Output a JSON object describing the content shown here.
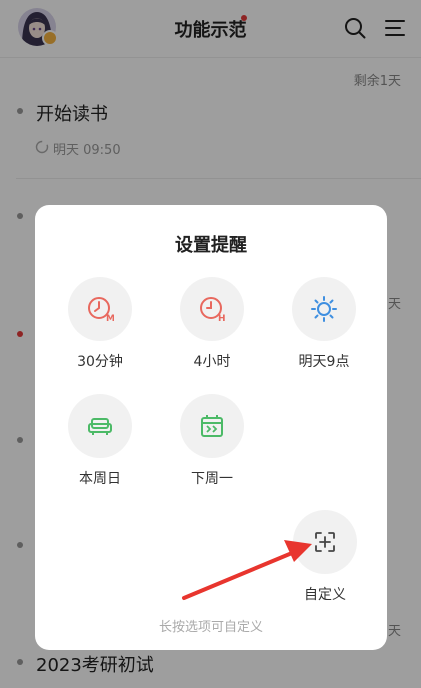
{
  "header": {
    "title": "功能示范",
    "avatar_icon": "avatar-icon",
    "search_icon": "search-icon",
    "menu_icon": "menu-icon"
  },
  "list": {
    "remaining_label": "剩余1天",
    "tasks": [
      {
        "title": "开始读书",
        "time": "明天 09:50"
      },
      {
        "title": "2023考研初试"
      }
    ],
    "partial_labels": [
      "天",
      "天"
    ]
  },
  "dialog": {
    "title": "设置提醒",
    "options": [
      {
        "label": "30分钟",
        "icon": "clock-m-icon"
      },
      {
        "label": "4小时",
        "icon": "clock-h-icon"
      },
      {
        "label": "明天9点",
        "icon": "sun-icon"
      },
      {
        "label": "本周日",
        "icon": "sofa-icon"
      },
      {
        "label": "下周一",
        "icon": "calendar-forward-icon"
      },
      {
        "label": "自定义",
        "icon": "custom-plus-icon"
      }
    ],
    "hint": "长按选项可自定义"
  },
  "colors": {
    "red_icon": "#e8685e",
    "blue_icon": "#3f8fe0",
    "green_icon": "#4cba67",
    "annotation_arrow": "#e8352e",
    "accent_dot": "#e63b3b"
  }
}
